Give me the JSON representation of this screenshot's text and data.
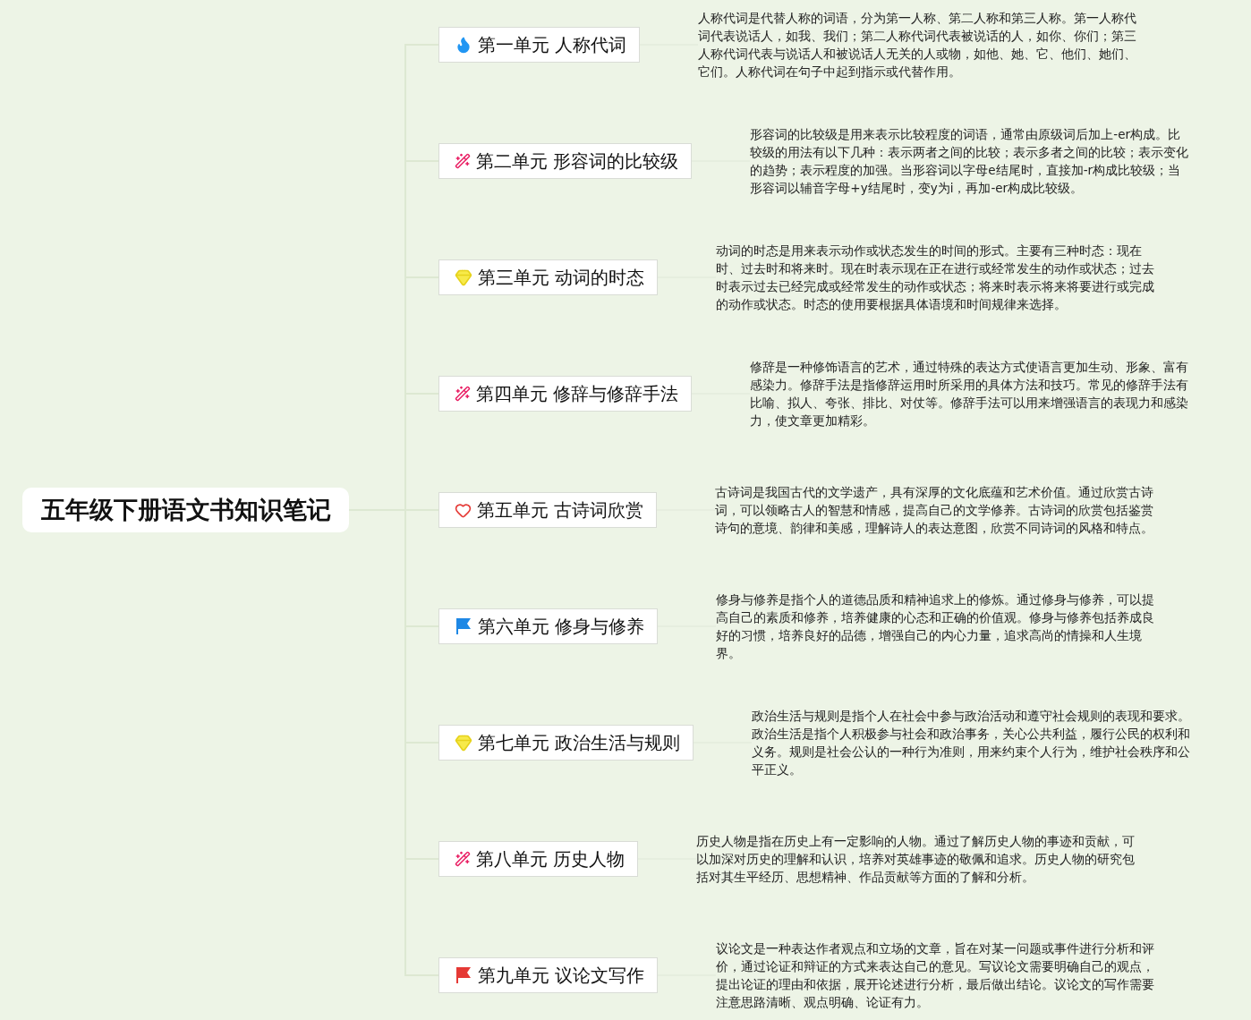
{
  "root": {
    "title": "五年级下册语文书知识笔记"
  },
  "branches": [
    {
      "kind": "fire",
      "label": "第一单元 人称代词",
      "note": "人称代词是代替人称的词语，分为第一人称、第二人称和第三人称。第一人称代词代表说话人，如我、我们；第二人称代词代表被说话的人，如你、你们；第三人称代词代表与说话人和被说话人无关的人或物，如他、她、它、他们、她们、它们。人称代词在句子中起到指示或代替作用。"
    },
    {
      "kind": "wand",
      "label": "第二单元 形容词的比较级",
      "note": "形容词的比较级是用来表示比较程度的词语，通常由原级词后加上-er构成。比较级的用法有以下几种：表示两者之间的比较；表示多者之间的比较；表示变化的趋势；表示程度的加强。当形容词以字母e结尾时，直接加-r构成比较级；当形容词以辅音字母+y结尾时，变y为i，再加-er构成比较级。"
    },
    {
      "kind": "gem",
      "label": "第三单元 动词的时态",
      "note": "动词的时态是用来表示动作或状态发生的时间的形式。主要有三种时态：现在时、过去时和将来时。现在时表示现在正在进行或经常发生的动作或状态；过去时表示过去已经完成或经常发生的动作或状态；将来时表示将来将要进行或完成的动作或状态。时态的使用要根据具体语境和时间规律来选择。"
    },
    {
      "kind": "wand",
      "label": "第四单元 修辞与修辞手法",
      "note": "修辞是一种修饰语言的艺术，通过特殊的表达方式使语言更加生动、形象、富有感染力。修辞手法是指修辞运用时所采用的具体方法和技巧。常见的修辞手法有比喻、拟人、夸张、排比、对仗等。修辞手法可以用来增强语言的表现力和感染力，使文章更加精彩。"
    },
    {
      "kind": "heart",
      "label": "第五单元 古诗词欣赏",
      "note": "古诗词是我国古代的文学遗产，具有深厚的文化底蕴和艺术价值。通过欣赏古诗词，可以领略古人的智慧和情感，提高自己的文学修养。古诗词的欣赏包括鉴赏诗句的意境、韵律和美感，理解诗人的表达意图，欣赏不同诗词的风格和特点。"
    },
    {
      "kind": "flag",
      "color": "#1e88e5",
      "label": "第六单元 修身与修养",
      "note": "修身与修养是指个人的道德品质和精神追求上的修炼。通过修身与修养，可以提高自己的素质和修养，培养健康的心态和正确的价值观。修身与修养包括养成良好的习惯，培养良好的品德，增强自己的内心力量，追求高尚的情操和人生境界。"
    },
    {
      "kind": "gem",
      "label": "第七单元 政治生活与规则",
      "note": "政治生活与规则是指个人在社会中参与政治活动和遵守社会规则的表现和要求。政治生活是指个人积极参与社会和政治事务，关心公共利益，履行公民的权利和义务。规则是社会公认的一种行为准则，用来约束个人行为，维护社会秩序和公平正义。"
    },
    {
      "kind": "wand",
      "label": "第八单元 历史人物",
      "note": "历史人物是指在历史上有一定影响的人物。通过了解历史人物的事迹和贡献，可以加深对历史的理解和认识，培养对英雄事迹的敬佩和追求。历史人物的研究包括对其生平经历、思想精神、作品贡献等方面的了解和分析。"
    },
    {
      "kind": "flag",
      "color": "#e53935",
      "label": "第九单元 议论文写作",
      "note": "议论文是一种表达作者观点和立场的文章，旨在对某一问题或事件进行分析和评价，通过论证和辩证的方式来表达自己的意见。写议论文需要明确自己的观点，提出论证的理由和依据，展开论述进行分析，最后做出结论。议论文的写作需要注意思路清晰、观点明确、论证有力。"
    }
  ]
}
